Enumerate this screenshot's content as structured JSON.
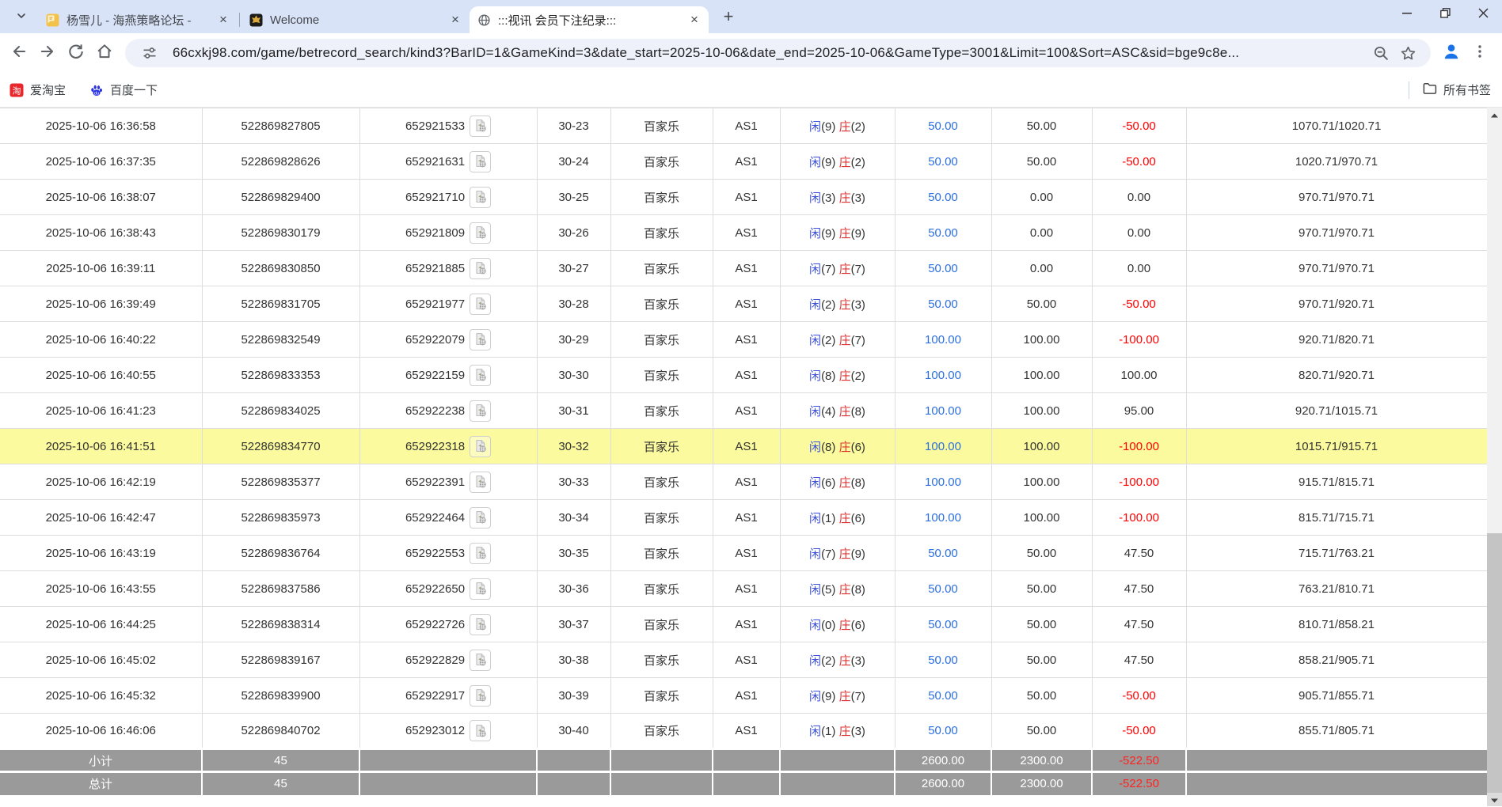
{
  "browser": {
    "tabs": [
      {
        "title": "杨雪儿 - 海燕策略论坛 -"
      },
      {
        "title": "Welcome"
      },
      {
        "title": ":::视讯 会员下注纪录:::"
      }
    ],
    "new_tab_label": "+",
    "url": "66cxkj98.com/game/betrecord_search/kind3?BarID=1&GameKind=3&date_start=2025-10-06&date_end=2025-10-06&GameType=3001&Limit=100&Sort=ASC&sid=bge9c8e...",
    "bookmarks": {
      "items": [
        {
          "label": "爱淘宝"
        },
        {
          "label": "百度一下"
        }
      ],
      "all_bookmarks_label": "所有书签"
    }
  },
  "page": {
    "result_labels": {
      "player": "闲",
      "banker": "庄"
    },
    "rows": [
      {
        "time": "2025-10-06 16:36:58",
        "bet_id": "522869827805",
        "round_id": "652921533",
        "table_no": "30-23",
        "game": "百家乐",
        "account": "AS1",
        "player": "9",
        "banker": "2",
        "bet": "50.00",
        "valid": "50.00",
        "winloss": "-50.00",
        "balance": "1070.71/1020.71",
        "highlight": false
      },
      {
        "time": "2025-10-06 16:37:35",
        "bet_id": "522869828626",
        "round_id": "652921631",
        "table_no": "30-24",
        "game": "百家乐",
        "account": "AS1",
        "player": "9",
        "banker": "2",
        "bet": "50.00",
        "valid": "50.00",
        "winloss": "-50.00",
        "balance": "1020.71/970.71",
        "highlight": false
      },
      {
        "time": "2025-10-06 16:38:07",
        "bet_id": "522869829400",
        "round_id": "652921710",
        "table_no": "30-25",
        "game": "百家乐",
        "account": "AS1",
        "player": "3",
        "banker": "3",
        "bet": "50.00",
        "valid": "0.00",
        "winloss": "0.00",
        "balance": "970.71/970.71",
        "highlight": false
      },
      {
        "time": "2025-10-06 16:38:43",
        "bet_id": "522869830179",
        "round_id": "652921809",
        "table_no": "30-26",
        "game": "百家乐",
        "account": "AS1",
        "player": "9",
        "banker": "9",
        "bet": "50.00",
        "valid": "0.00",
        "winloss": "0.00",
        "balance": "970.71/970.71",
        "highlight": false
      },
      {
        "time": "2025-10-06 16:39:11",
        "bet_id": "522869830850",
        "round_id": "652921885",
        "table_no": "30-27",
        "game": "百家乐",
        "account": "AS1",
        "player": "7",
        "banker": "7",
        "bet": "50.00",
        "valid": "0.00",
        "winloss": "0.00",
        "balance": "970.71/970.71",
        "highlight": false
      },
      {
        "time": "2025-10-06 16:39:49",
        "bet_id": "522869831705",
        "round_id": "652921977",
        "table_no": "30-28",
        "game": "百家乐",
        "account": "AS1",
        "player": "2",
        "banker": "3",
        "bet": "50.00",
        "valid": "50.00",
        "winloss": "-50.00",
        "balance": "970.71/920.71",
        "highlight": false
      },
      {
        "time": "2025-10-06 16:40:22",
        "bet_id": "522869832549",
        "round_id": "652922079",
        "table_no": "30-29",
        "game": "百家乐",
        "account": "AS1",
        "player": "2",
        "banker": "7",
        "bet": "100.00",
        "valid": "100.00",
        "winloss": "-100.00",
        "balance": "920.71/820.71",
        "highlight": false
      },
      {
        "time": "2025-10-06 16:40:55",
        "bet_id": "522869833353",
        "round_id": "652922159",
        "table_no": "30-30",
        "game": "百家乐",
        "account": "AS1",
        "player": "8",
        "banker": "2",
        "bet": "100.00",
        "valid": "100.00",
        "winloss": "100.00",
        "balance": "820.71/920.71",
        "highlight": false
      },
      {
        "time": "2025-10-06 16:41:23",
        "bet_id": "522869834025",
        "round_id": "652922238",
        "table_no": "30-31",
        "game": "百家乐",
        "account": "AS1",
        "player": "4",
        "banker": "8",
        "bet": "100.00",
        "valid": "100.00",
        "winloss": "95.00",
        "balance": "920.71/1015.71",
        "highlight": false
      },
      {
        "time": "2025-10-06 16:41:51",
        "bet_id": "522869834770",
        "round_id": "652922318",
        "table_no": "30-32",
        "game": "百家乐",
        "account": "AS1",
        "player": "8",
        "banker": "6",
        "bet": "100.00",
        "valid": "100.00",
        "winloss": "-100.00",
        "balance": "1015.71/915.71",
        "highlight": true
      },
      {
        "time": "2025-10-06 16:42:19",
        "bet_id": "522869835377",
        "round_id": "652922391",
        "table_no": "30-33",
        "game": "百家乐",
        "account": "AS1",
        "player": "6",
        "banker": "8",
        "bet": "100.00",
        "valid": "100.00",
        "winloss": "-100.00",
        "balance": "915.71/815.71",
        "highlight": false
      },
      {
        "time": "2025-10-06 16:42:47",
        "bet_id": "522869835973",
        "round_id": "652922464",
        "table_no": "30-34",
        "game": "百家乐",
        "account": "AS1",
        "player": "1",
        "banker": "6",
        "bet": "100.00",
        "valid": "100.00",
        "winloss": "-100.00",
        "balance": "815.71/715.71",
        "highlight": false
      },
      {
        "time": "2025-10-06 16:43:19",
        "bet_id": "522869836764",
        "round_id": "652922553",
        "table_no": "30-35",
        "game": "百家乐",
        "account": "AS1",
        "player": "7",
        "banker": "9",
        "bet": "50.00",
        "valid": "50.00",
        "winloss": "47.50",
        "balance": "715.71/763.21",
        "highlight": false
      },
      {
        "time": "2025-10-06 16:43:55",
        "bet_id": "522869837586",
        "round_id": "652922650",
        "table_no": "30-36",
        "game": "百家乐",
        "account": "AS1",
        "player": "5",
        "banker": "8",
        "bet": "50.00",
        "valid": "50.00",
        "winloss": "47.50",
        "balance": "763.21/810.71",
        "highlight": false
      },
      {
        "time": "2025-10-06 16:44:25",
        "bet_id": "522869838314",
        "round_id": "652922726",
        "table_no": "30-37",
        "game": "百家乐",
        "account": "AS1",
        "player": "0",
        "banker": "6",
        "bet": "50.00",
        "valid": "50.00",
        "winloss": "47.50",
        "balance": "810.71/858.21",
        "highlight": false
      },
      {
        "time": "2025-10-06 16:45:02",
        "bet_id": "522869839167",
        "round_id": "652922829",
        "table_no": "30-38",
        "game": "百家乐",
        "account": "AS1",
        "player": "2",
        "banker": "3",
        "bet": "50.00",
        "valid": "50.00",
        "winloss": "47.50",
        "balance": "858.21/905.71",
        "highlight": false
      },
      {
        "time": "2025-10-06 16:45:32",
        "bet_id": "522869839900",
        "round_id": "652922917",
        "table_no": "30-39",
        "game": "百家乐",
        "account": "AS1",
        "player": "9",
        "banker": "7",
        "bet": "50.00",
        "valid": "50.00",
        "winloss": "-50.00",
        "balance": "905.71/855.71",
        "highlight": false
      },
      {
        "time": "2025-10-06 16:46:06",
        "bet_id": "522869840702",
        "round_id": "652923012",
        "table_no": "30-40",
        "game": "百家乐",
        "account": "AS1",
        "player": "1",
        "banker": "3",
        "bet": "50.00",
        "valid": "50.00",
        "winloss": "-50.00",
        "balance": "855.71/805.71",
        "highlight": false
      }
    ],
    "footer": [
      {
        "label": "小计",
        "count": "45",
        "bet": "2600.00",
        "valid": "2300.00",
        "winloss": "-522.50"
      },
      {
        "label": "总计",
        "count": "45",
        "bet": "2600.00",
        "valid": "2300.00",
        "winloss": "-522.50"
      }
    ]
  },
  "colors": {
    "tabstrip_bg": "#d9e3f8",
    "highlight_row": "#fbfa9e",
    "bet_blue": "#2b6fe0",
    "player_blue": "#3c50d9",
    "banker_red": "#e03030",
    "loss_red": "#fe0000",
    "footer_bg": "#9a9a9a"
  }
}
